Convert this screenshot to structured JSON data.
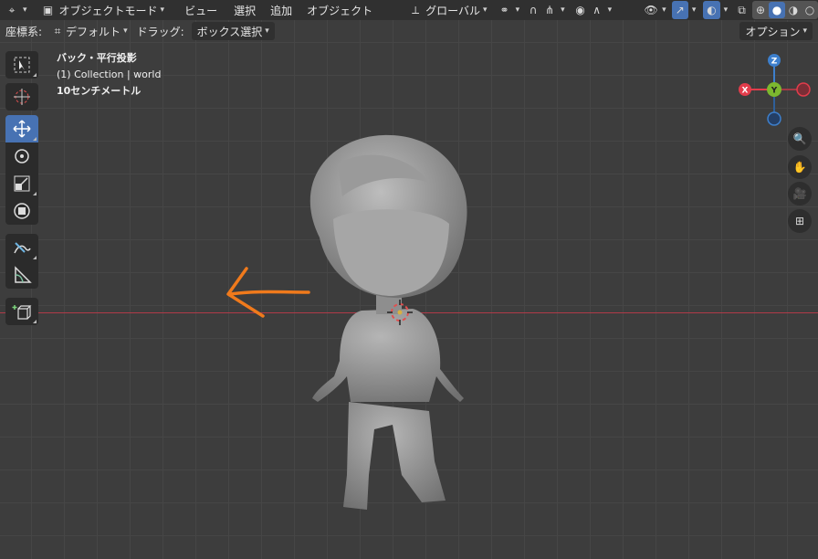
{
  "header": {
    "mode_label": "オブジェクトモード",
    "menu": [
      "ビュー",
      "選択",
      "追加",
      "オブジェクト"
    ],
    "transform_orientation": "グローバル"
  },
  "subheader": {
    "coord_label": "座標系:",
    "coord_value": "デフォルト",
    "drag_label": "ドラッグ:",
    "drag_value": "ボックス選択",
    "options_label": "オプション"
  },
  "overlay": {
    "view_name": "バック・平行投影",
    "collection": "(1) Collection | world",
    "scale": "10センチメートル"
  },
  "gizmo": {
    "z": "Z",
    "x": "X",
    "y": "Y"
  },
  "colors": {
    "accent": "#4772b3",
    "axis_x": "#e23c4b",
    "axis_y": "#7cb82f",
    "axis_z": "#3d7fcc",
    "annotation": "#f07a1c"
  },
  "tools": [
    "select-box",
    "cursor",
    "move",
    "rotate",
    "scale",
    "transform",
    "annotate",
    "measure",
    "add-cube"
  ],
  "active_tool": "move"
}
